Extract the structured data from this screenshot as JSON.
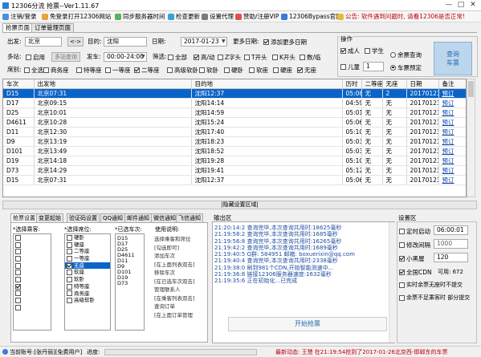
{
  "window": {
    "title": "12306分流 抢票--Ver1.11.67",
    "min": "—",
    "max": "□",
    "close": "✕"
  },
  "toolbar": {
    "login": "注销/登录",
    "free_login": "免登录打开12306网站",
    "sync_time": "同步服务器时间",
    "check_update": "检查更新",
    "proxy": "设置代理",
    "donate": "赞助/注册VIP",
    "bypass": "12306Bypass官网",
    "notice": "公告: 软件遇到问题时, 请看12306是否正常!"
  },
  "tabs": [
    "抢票页面",
    "订单管理页面"
  ],
  "query": {
    "from_label": "出发:",
    "from_value": "北京",
    "swap": "<->",
    "to_label": "目的:",
    "to_value": "沈阳",
    "date_label": "日期:",
    "date_value": "2017-01-23",
    "more_dates_label": "更多日期:",
    "add_more_dates": "添加更多日期",
    "multi_station_label": "多站:",
    "enable": "启用",
    "multi_station_btn": "多站查询",
    "depart_label": "发车:",
    "depart_value": "00:00-24:00",
    "filter_label": "筛选:",
    "filters": [
      "全部",
      "高/动",
      "Z字头",
      "T开头",
      "K开头",
      "数/临"
    ],
    "filters_on": [
      false,
      true,
      false,
      false,
      false,
      false
    ],
    "seat_label": "席别:",
    "seats": [
      "全选",
      "商务座",
      "特等座",
      "一等座",
      "二等座",
      "高级软卧",
      "软卧",
      "硬卧",
      "软座",
      "硬座",
      "无座"
    ],
    "seats_on": [
      false,
      false,
      false,
      false,
      true,
      false,
      false,
      false,
      false,
      false,
      true
    ]
  },
  "operation": {
    "title": "操作",
    "adult": "成人",
    "student": "学生",
    "child": "儿童",
    "child_count": "1",
    "remaining": "余票查询",
    "station_booking": "车票预定",
    "query_btn": "查询\n车票"
  },
  "table": {
    "headers": [
      "车次",
      "出发地",
      "目的地",
      "历时",
      "二等座",
      "无座",
      "日期",
      "备注"
    ],
    "rows": [
      [
        "D15",
        "北京07:31",
        "沈阳12:37",
        "05:06",
        "无",
        "2",
        "20170123",
        "预订"
      ],
      [
        "D17",
        "北京09:15",
        "沈阳14:14",
        "04:59",
        "无",
        "无",
        "20170123",
        "预订"
      ],
      [
        "D25",
        "北京10:01",
        "沈阳14:59",
        "05:01",
        "无",
        "无",
        "20170123",
        "预订"
      ],
      [
        "D4611",
        "北京10:28",
        "沈阳15:24",
        "05:06",
        "无",
        "无",
        "20170123",
        "预订"
      ],
      [
        "D11",
        "北京12:30",
        "沈阳17:40",
        "05:10",
        "无",
        "无",
        "20170123",
        "预订"
      ],
      [
        "D9",
        "北京13:19",
        "沈阳18:23",
        "05:03",
        "无",
        "无",
        "20170123",
        "预订"
      ],
      [
        "D101",
        "北京13:49",
        "沈阳18:52",
        "05:03",
        "无",
        "无",
        "20170123",
        "预订"
      ],
      [
        "D19",
        "北京14:18",
        "沈阳19:28",
        "05:10",
        "无",
        "无",
        "20170123",
        "预订"
      ],
      [
        "D73",
        "北京14:29",
        "沈阳19:41",
        "05:12",
        "无",
        "无",
        "20170123",
        "预订"
      ],
      [
        "D15",
        "北京07:31",
        "沈阳12:37",
        "05:06",
        "无",
        "无",
        "20170123",
        "预订"
      ]
    ]
  },
  "hide_settings": "|隐藏设置区域|",
  "bottom_tabs": [
    "抢票设置",
    "变更起始",
    "验证码设置",
    "QQ通知",
    "邮件通知",
    "微信通知",
    "飞信通知"
  ],
  "seat_select": {
    "label": "*选择乘客:",
    "passengers_on": [
      false,
      false,
      false,
      false,
      false,
      false,
      false,
      true,
      false,
      false,
      false
    ],
    "seat_label": "*选择席位:",
    "seats": [
      "硬卧",
      "硬座",
      "二等座",
      "一等座",
      "无座",
      "软座",
      "软卧",
      "特等座",
      "商务座",
      "高级软卧"
    ],
    "seats_on": [
      false,
      false,
      false,
      false,
      true,
      false,
      false,
      false,
      false,
      false
    ],
    "selected_seat_index": 4
  },
  "trains_added": {
    "label": "*已选车次:",
    "items": [
      "D15",
      "D17",
      "D25",
      "D4611",
      "D11",
      "D9",
      "D101",
      "D19",
      "D73"
    ]
  },
  "help": {
    "label": "使用说明:",
    "lines": [
      "选择乘客和席位",
      "[勾选即可]",
      "添加车次",
      "[在上面列表双击]",
      "移除车次",
      "[在已选车次双击]",
      "管理联系人",
      "[在乘客列表双击]",
      "查询订单",
      "[在上面订单管理"
    ]
  },
  "output": {
    "title": "输出区",
    "lines": [
      "21:20:14:2  查询完毕,本次查询共用时:18625毫秒",
      "21:19:58:2  查询完毕,本次查询共用时:1685毫秒",
      "21:19:56:8  查询完毕,本次查询共用时:16265毫秒",
      "21:19:42:2  查询完毕,本次查询共用时:1689毫秒",
      "21:19:40:5  Q群: 584951 邮箱: boxuerixin@qq.com",
      "21:19:40:4  查询完毕,本次查询共用时:2338毫秒",
      "21:19:38:0  刷到981个CDN,开始智能测速中...",
      "21:19:36:8  链接12306服务器速度:1632毫秒",
      "21:19:35:6  正在初始化...已完成"
    ],
    "start_btn": "开始抢票"
  },
  "settings": {
    "title": "设置区",
    "timed_start": "定时启动",
    "timed_value": "06:00:01",
    "interval": "修改间隔",
    "interval_value": "1000",
    "small_black": "小黑屋",
    "small_black_value": "120",
    "full_cdn": "全国CDN",
    "cdn_label": "可用: 672",
    "realtime": "实时余票无座时不提交",
    "insufficient": "余票不足乘客时 部分提交",
    "checks": [
      false,
      false,
      true,
      true,
      false,
      false
    ]
  },
  "status": {
    "account": "当前账号:[张丹丽][免费用户]",
    "progress": "进度:",
    "news": "最新动态: 王慧 在21:19:54抢到了2017-01-26北京西-邯郸东的车票"
  }
}
